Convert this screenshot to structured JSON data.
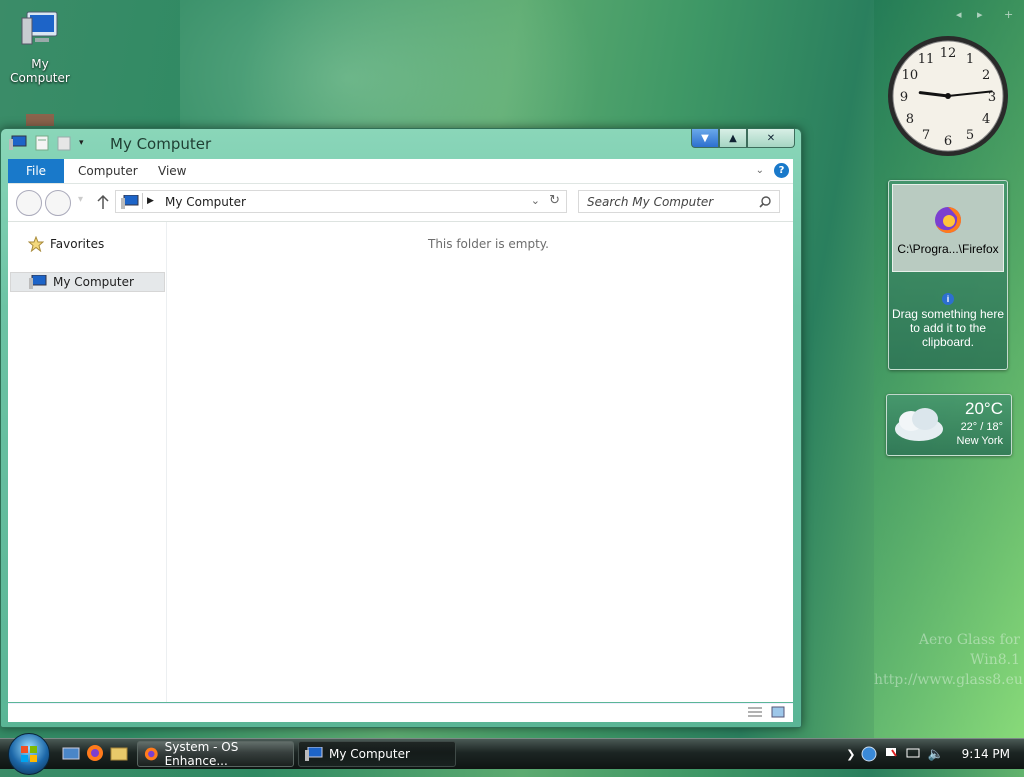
{
  "desktop": {
    "icons": [
      {
        "label": "My Computer",
        "icon": "computer-icon"
      }
    ],
    "watermark": [
      "Aero Glass for Win8.1",
      "http://www.glass8.eu"
    ]
  },
  "sidebar": {
    "controls": [
      "◂",
      "▸",
      "+"
    ],
    "clock": {
      "time": "9:14",
      "hour": 9,
      "minute": 14
    },
    "clipboard": {
      "item_label": "C:\\Progra...\\Firefox",
      "info_text": "Drag something here to add it to the clipboard."
    },
    "weather": {
      "temp": "20°C",
      "hilo": "22° / 18°",
      "city": "New York"
    }
  },
  "window": {
    "title": "My Computer",
    "tabs": [
      "File",
      "Computer",
      "View"
    ],
    "address": "My Computer",
    "search_placeholder": "Search My Computer",
    "nav": {
      "favorites": "Favorites",
      "selected": "My Computer"
    },
    "empty_message": "This folder is empty."
  },
  "taskbar": {
    "buttons": [
      {
        "label": "System - OS Enhance...",
        "icon": "firefox-icon",
        "active": false
      },
      {
        "label": "My Computer",
        "icon": "computer-icon",
        "active": true
      }
    ],
    "time": "9:14 PM"
  },
  "colors": {
    "accent": "#1979ca",
    "window_chrome": "#6cc3a4"
  }
}
